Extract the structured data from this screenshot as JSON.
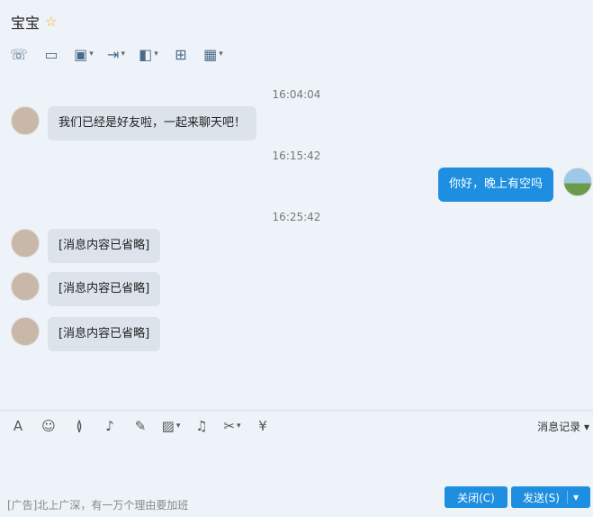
{
  "title": "宝宝",
  "toolbar": {
    "icons": [
      "phone-icon",
      "video-icon",
      "screen-share-icon",
      "file-transfer-icon",
      "remote-desktop-icon",
      "add-message-icon",
      "apps-icon"
    ]
  },
  "messages": [
    {
      "time": "16:04:04"
    },
    {
      "text": "我们已经是好友啦，一起来聊天吧！"
    },
    {
      "time": "16:15:42"
    },
    {
      "text": "你好，晚上有空吗"
    },
    {
      "time": "16:25:42"
    },
    {
      "text": "[消息内容已省略]"
    },
    {
      "text": "[消息内容已省略]"
    },
    {
      "text": "[消息内容已省略]"
    }
  ],
  "input_toolbar": {
    "history_label": "消息记录"
  },
  "ad_text": "[广告]北上广深，有一万个理由要加班",
  "buttons": {
    "close_label": "关闭(C)",
    "send_label": "发送(S)"
  }
}
